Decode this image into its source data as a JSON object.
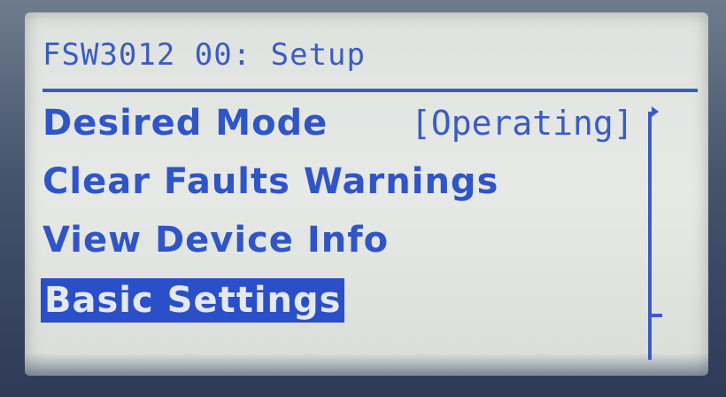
{
  "header": {
    "title": "FSW3012 00: Setup"
  },
  "menu": {
    "items": [
      {
        "label": "Desired Mode",
        "value": "[Operating]"
      },
      {
        "label": "Clear Faults Warnings"
      },
      {
        "label": "View Device Info"
      },
      {
        "label": "Basic Settings",
        "selected": true
      }
    ]
  },
  "colors": {
    "lcd_background": "#e0e4e0",
    "lcd_text": "#2f55c8",
    "selection_bg": "#2a4fc8"
  }
}
